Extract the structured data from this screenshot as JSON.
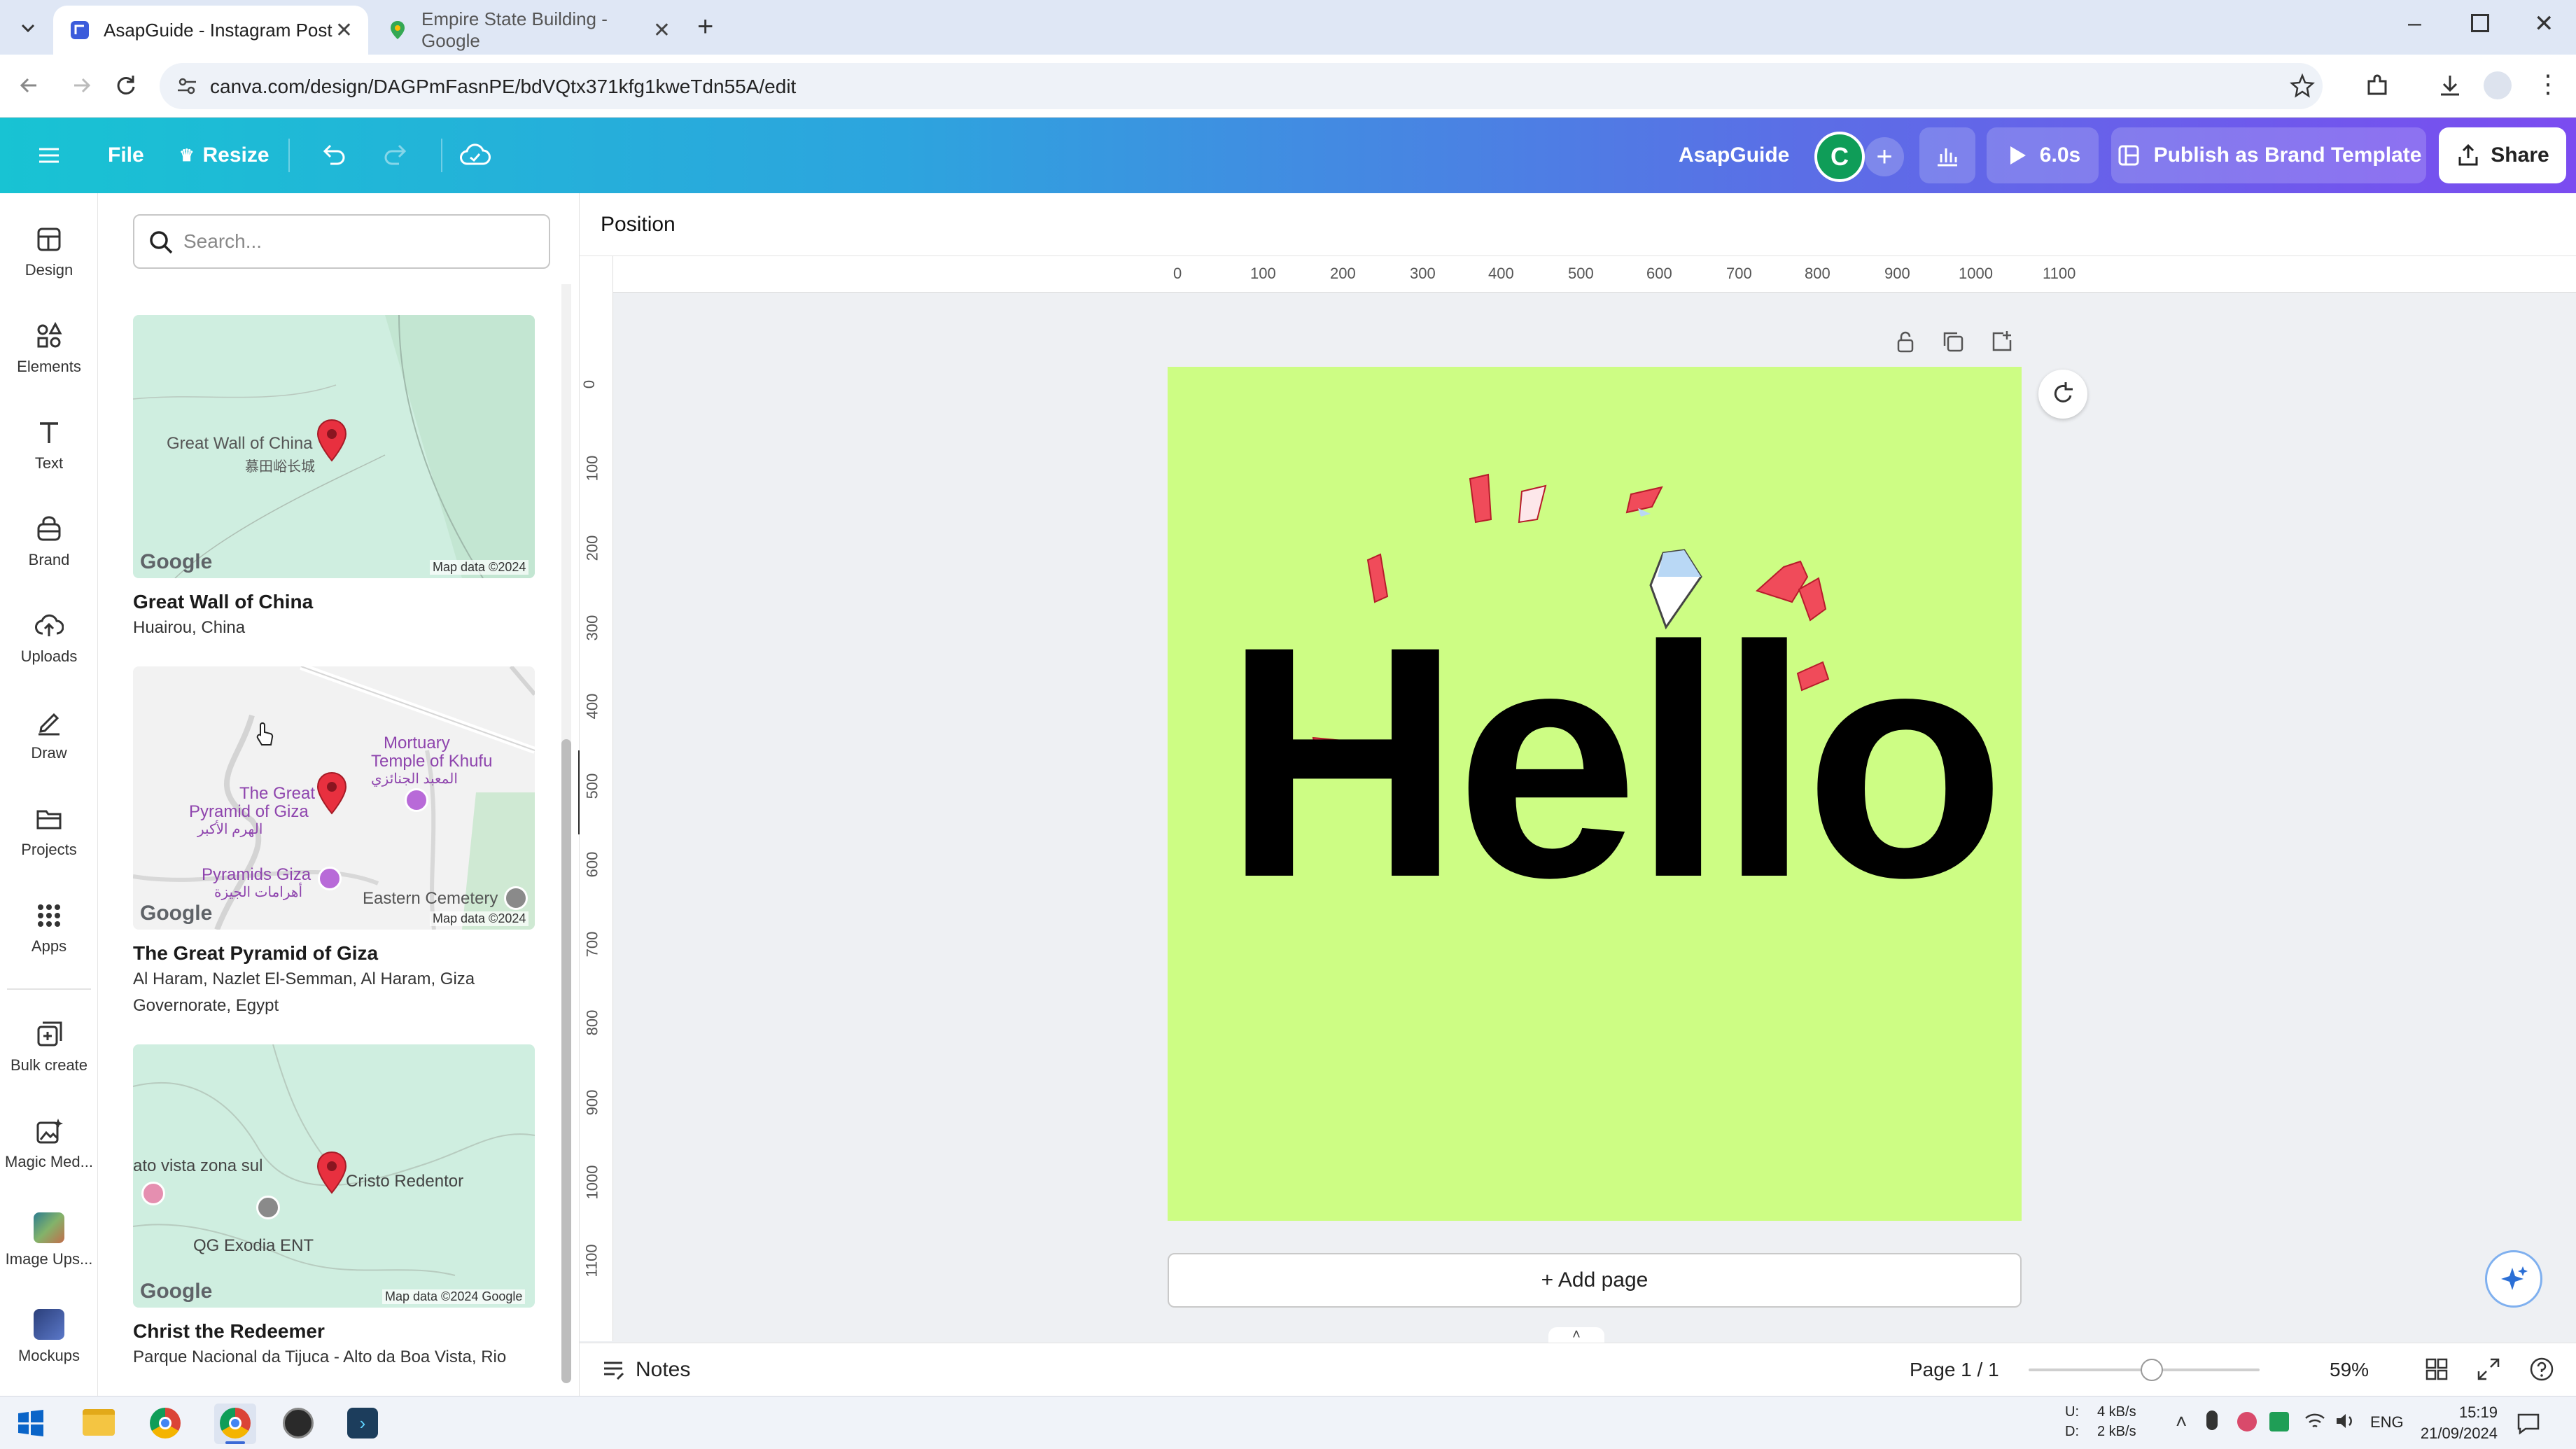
{
  "browser": {
    "tabs": [
      {
        "title": "AsapGuide - Instagram Post",
        "active": true
      },
      {
        "title": "Empire State Building - Google",
        "active": false
      }
    ],
    "url": "canva.com/design/DAGPmFasnPE/bdVQtx371kfg1kweTdn55A/edit"
  },
  "header": {
    "file_label": "File",
    "resize_label": "Resize",
    "team_name": "AsapGuide",
    "avatar_letter": "C",
    "timer_label": "6.0s",
    "publish_label": "Publish as Brand Template",
    "share_label": "Share"
  },
  "rail": {
    "items": [
      {
        "label": "Design",
        "icon": "design-icon"
      },
      {
        "label": "Elements",
        "icon": "elements-icon"
      },
      {
        "label": "Text",
        "icon": "text-icon"
      },
      {
        "label": "Brand",
        "icon": "brand-icon"
      },
      {
        "label": "Uploads",
        "icon": "upload-icon"
      },
      {
        "label": "Draw",
        "icon": "draw-icon"
      },
      {
        "label": "Projects",
        "icon": "folder-icon"
      },
      {
        "label": "Apps",
        "icon": "apps-icon"
      },
      {
        "label": "Bulk create",
        "icon": "bulk-create-icon"
      },
      {
        "label": "Magic Med...",
        "icon": "magic-media-icon"
      },
      {
        "label": "Image Ups...",
        "icon": "image-upscaler-icon"
      },
      {
        "label": "Mockups",
        "icon": "mockups-icon"
      }
    ]
  },
  "panel": {
    "search_placeholder": "Search...",
    "results": [
      {
        "title": "Great Wall of China",
        "subtitle": "Huairou, China",
        "map_labels": [
          "Great Wall of China",
          "慕田峪长城"
        ],
        "attribution": "Map data ©2024"
      },
      {
        "title": "The Great Pyramid of Giza",
        "subtitle": "Al Haram, Nazlet El-Semman, Al Haram, Giza Governorate, Egypt",
        "map_labels": [
          "Mortuary",
          "Temple of Khufu",
          "المعبد الجنائزي",
          "The Great",
          "Pyramid of Giza",
          "الهرم الأكبر",
          "Pyramids Giza",
          "أهرامات الجيزة",
          "Eastern Cemetery"
        ],
        "attribution": "Map data ©2024"
      },
      {
        "title": "Christ the Redeemer",
        "subtitle": "Parque Nacional da Tijuca - Alto da Boa Vista, Rio",
        "map_labels": [
          "ato vista zona sul",
          "Cristo Redentor",
          "QG Exodia ENT"
        ],
        "attribution": "Map data ©2024 Google"
      }
    ],
    "google_label": "Google"
  },
  "toolbar": {
    "position_label": "Position"
  },
  "ruler": {
    "h_ticks": [
      "0",
      "100",
      "200",
      "300",
      "400",
      "500",
      "600",
      "700",
      "800",
      "900",
      "1000",
      "1100"
    ],
    "v_ticks": [
      "0",
      "100",
      "200",
      "300",
      "400",
      "500",
      "600",
      "700",
      "800",
      "900",
      "1000",
      "1100"
    ]
  },
  "canvas": {
    "headline": "Hello",
    "background_color": "#cdfd84",
    "add_page_label": "+ Add page"
  },
  "footer": {
    "notes_label": "Notes",
    "page_label": "Page 1 / 1",
    "zoom_label": "59%",
    "zoom_value": 59
  },
  "taskbar": {
    "net_up_label": "U:",
    "net_down_label": "D:",
    "net_up_value": "4 kB/s",
    "net_down_value": "2 kB/s",
    "language": "ENG",
    "time": "15:19",
    "date": "21/09/2024"
  }
}
